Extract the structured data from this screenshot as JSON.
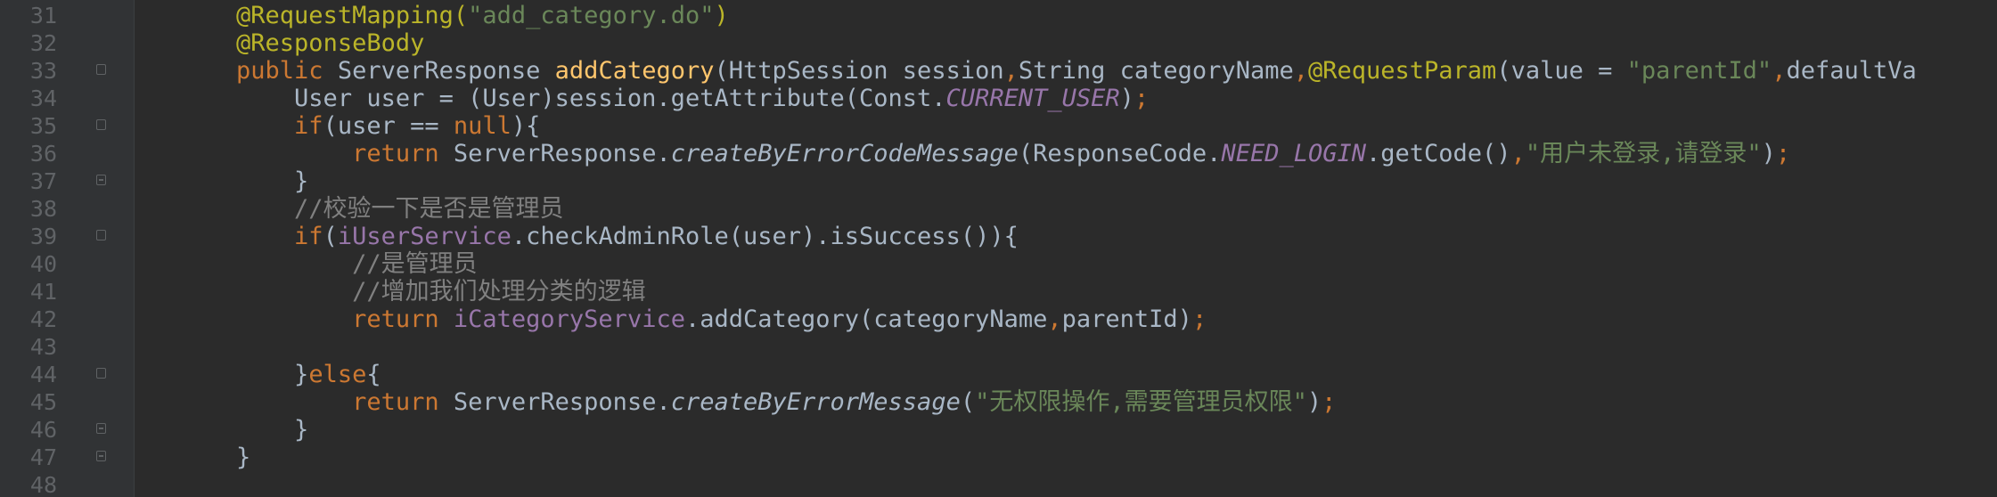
{
  "editor": {
    "lines": [
      {
        "number": "31",
        "fold": "none",
        "indent": "    ",
        "tokens": [
          {
            "k": "ann",
            "v": "@RequestMapping("
          },
          {
            "k": "str",
            "v": "\"add_category.do\""
          },
          {
            "k": "ann",
            "v": ")"
          }
        ]
      },
      {
        "number": "32",
        "fold": "none",
        "indent": "    ",
        "tokens": [
          {
            "k": "ann",
            "v": "@ResponseBody"
          }
        ]
      },
      {
        "number": "33",
        "fold": "start",
        "indent": "    ",
        "tokens": [
          {
            "k": "kw",
            "v": "public "
          },
          {
            "k": "txt",
            "v": "ServerResponse "
          },
          {
            "k": "fn",
            "v": "addCategory"
          },
          {
            "k": "txt",
            "v": "(HttpSession session"
          },
          {
            "k": "kw",
            "v": ","
          },
          {
            "k": "txt",
            "v": "String categoryName"
          },
          {
            "k": "kw",
            "v": ","
          },
          {
            "k": "ann",
            "v": "@RequestParam"
          },
          {
            "k": "txt",
            "v": "(value = "
          },
          {
            "k": "str",
            "v": "\"parentId\""
          },
          {
            "k": "kw",
            "v": ","
          },
          {
            "k": "txt",
            "v": "defaultVa"
          }
        ]
      },
      {
        "number": "34",
        "fold": "none",
        "indent": "        ",
        "tokens": [
          {
            "k": "txt",
            "v": "User user = (User)session.getAttribute(Const."
          },
          {
            "k": "const",
            "v": "CURRENT_USER"
          },
          {
            "k": "txt",
            "v": ")"
          },
          {
            "k": "kw",
            "v": ";"
          }
        ]
      },
      {
        "number": "35",
        "fold": "start",
        "indent": "        ",
        "tokens": [
          {
            "k": "kw",
            "v": "if"
          },
          {
            "k": "txt",
            "v": "(user == "
          },
          {
            "k": "kw",
            "v": "null"
          },
          {
            "k": "txt",
            "v": "){"
          }
        ]
      },
      {
        "number": "36",
        "fold": "none",
        "indent": "            ",
        "tokens": [
          {
            "k": "kw",
            "v": "return "
          },
          {
            "k": "txt",
            "v": "ServerResponse."
          },
          {
            "k": "it",
            "v": "createByErrorCodeMessage"
          },
          {
            "k": "txt",
            "v": "(ResponseCode."
          },
          {
            "k": "const",
            "v": "NEED_LOGIN"
          },
          {
            "k": "txt",
            "v": ".getCode()"
          },
          {
            "k": "kw",
            "v": ","
          },
          {
            "k": "str",
            "v": "\"用户未登录,请登录\""
          },
          {
            "k": "txt",
            "v": ")"
          },
          {
            "k": "kw",
            "v": ";"
          }
        ]
      },
      {
        "number": "37",
        "fold": "end",
        "indent": "        ",
        "tokens": [
          {
            "k": "txt",
            "v": "}"
          }
        ]
      },
      {
        "number": "38",
        "fold": "none",
        "indent": "        ",
        "tokens": [
          {
            "k": "cm",
            "v": "//校验一下是否是管理员"
          }
        ]
      },
      {
        "number": "39",
        "fold": "start",
        "indent": "        ",
        "tokens": [
          {
            "k": "kw",
            "v": "if"
          },
          {
            "k": "txt",
            "v": "("
          },
          {
            "k": "fld",
            "v": "iUserService"
          },
          {
            "k": "txt",
            "v": ".checkAdminRole(user).isSuccess()){"
          }
        ]
      },
      {
        "number": "40",
        "fold": "none",
        "indent": "            ",
        "tokens": [
          {
            "k": "cm",
            "v": "//是管理员"
          }
        ]
      },
      {
        "number": "41",
        "fold": "none",
        "indent": "            ",
        "tokens": [
          {
            "k": "cm",
            "v": "//增加我们处理分类的逻辑"
          }
        ]
      },
      {
        "number": "42",
        "fold": "none",
        "indent": "            ",
        "tokens": [
          {
            "k": "kw",
            "v": "return "
          },
          {
            "k": "fld",
            "v": "iCategoryService"
          },
          {
            "k": "txt",
            "v": ".addCategory(categoryName"
          },
          {
            "k": "kw",
            "v": ","
          },
          {
            "k": "txt",
            "v": "parentId)"
          },
          {
            "k": "kw",
            "v": ";"
          }
        ]
      },
      {
        "number": "43",
        "fold": "none",
        "indent": "",
        "tokens": []
      },
      {
        "number": "44",
        "fold": "start",
        "indent": "        ",
        "tokens": [
          {
            "k": "txt",
            "v": "}"
          },
          {
            "k": "kw",
            "v": "else"
          },
          {
            "k": "txt",
            "v": "{"
          }
        ]
      },
      {
        "number": "45",
        "fold": "none",
        "indent": "            ",
        "tokens": [
          {
            "k": "kw",
            "v": "return "
          },
          {
            "k": "txt",
            "v": "ServerResponse."
          },
          {
            "k": "it",
            "v": "createByErrorMessage"
          },
          {
            "k": "txt",
            "v": "("
          },
          {
            "k": "str",
            "v": "\"无权限操作,需要管理员权限\""
          },
          {
            "k": "txt",
            "v": ")"
          },
          {
            "k": "kw",
            "v": ";"
          }
        ]
      },
      {
        "number": "46",
        "fold": "end",
        "indent": "        ",
        "tokens": [
          {
            "k": "txt",
            "v": "}"
          }
        ]
      },
      {
        "number": "47",
        "fold": "end",
        "indent": "    ",
        "tokens": [
          {
            "k": "txt",
            "v": "}"
          }
        ]
      },
      {
        "number": "48",
        "fold": "none",
        "indent": "",
        "tokens": []
      }
    ]
  }
}
